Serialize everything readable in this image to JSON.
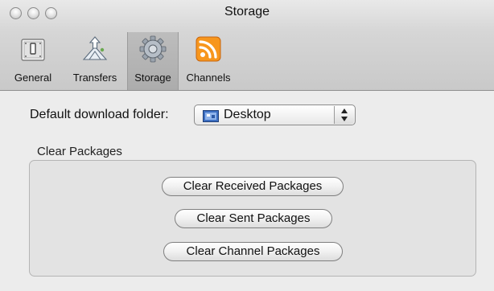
{
  "window": {
    "title": "Storage"
  },
  "toolbar": {
    "tabs": [
      {
        "label": "General",
        "icon": "switch-icon"
      },
      {
        "label": "Transfers",
        "icon": "transfers-icon"
      },
      {
        "label": "Storage",
        "icon": "gear-icon"
      },
      {
        "label": "Channels",
        "icon": "rss-feed-icon"
      }
    ],
    "selected_tab": "Storage"
  },
  "storage": {
    "download_folder_label": "Default download folder:",
    "download_folder_value": "Desktop",
    "clear_group_label": "Clear Packages",
    "buttons": {
      "clear_received": "Clear Received Packages",
      "clear_sent": "Clear Sent Packages",
      "clear_channel": "Clear Channel Packages"
    }
  },
  "colors": {
    "rss_orange": "#f7961d",
    "folder_blue": "#3d6fc2"
  }
}
